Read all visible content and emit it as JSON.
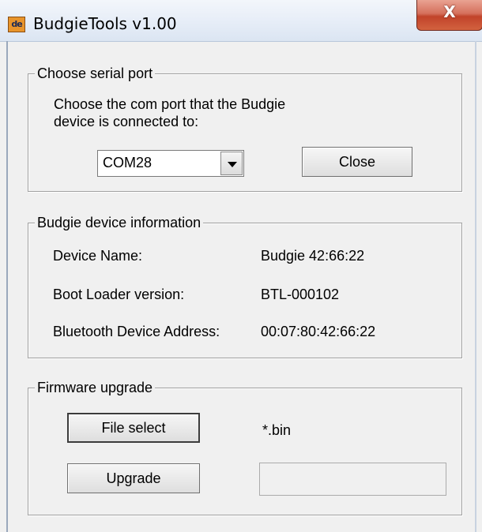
{
  "window": {
    "title": "BudgieTools v1.00",
    "app_icon_text": "de",
    "close_glyph": "X"
  },
  "serial_port": {
    "group_label": "Choose serial port",
    "instruction_line1": "Choose the com port that the Budgie",
    "instruction_line2": "device is connected to:",
    "selected_port": "COM28",
    "close_label": "Close"
  },
  "device_info": {
    "group_label": "Budgie device information",
    "rows": [
      {
        "label": "Device Name:",
        "value": "Budgie 42:66:22"
      },
      {
        "label": "Boot Loader version:",
        "value": "BTL-000102"
      },
      {
        "label": "Bluetooth Device Address:",
        "value": "00:07:80:42:66:22"
      }
    ]
  },
  "firmware": {
    "group_label": "Firmware upgrade",
    "file_select_label": "File select",
    "file_filter": "*.bin",
    "upgrade_label": "Upgrade",
    "status_value": ""
  }
}
